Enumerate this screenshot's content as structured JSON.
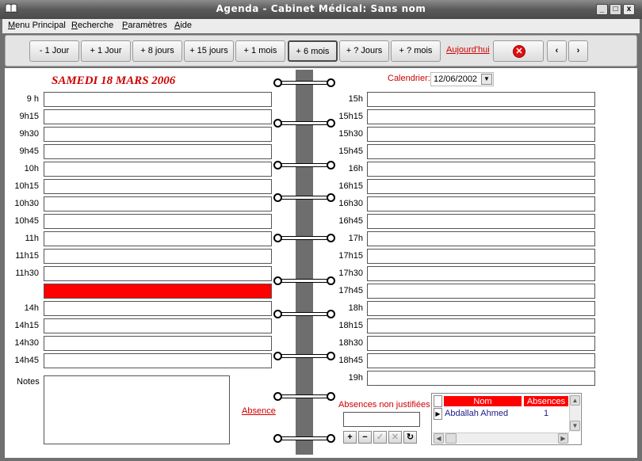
{
  "window": {
    "title": "Agenda - Cabinet Médical: Sans nom",
    "minimize": "_",
    "maximize": "□",
    "close": "x"
  },
  "menu": [
    {
      "label": "Menu Principal",
      "u": "M",
      "rest": "enu Principal"
    },
    {
      "label": "Recherche",
      "u": "R",
      "rest": "echerche"
    },
    {
      "label": "Paramètres",
      "u": "P",
      "rest": "aramètres"
    },
    {
      "label": "Aide",
      "u": "A",
      "rest": "ide"
    }
  ],
  "toolbar": {
    "buttons": [
      "- 1 Jour",
      "+ 1 Jour",
      "+ 8 jours",
      "+ 15 jours",
      "+ 1 mois",
      "+ 6 mois",
      "+ ? Jours",
      "+ ? mois"
    ],
    "today": "Aujourd'hui",
    "prev": "‹",
    "next": "›"
  },
  "day": {
    "title": "SAMEDI 18 MARS 2006"
  },
  "calendar": {
    "label": "Calendrier:",
    "value": "12/06/2002"
  },
  "left_slots": [
    "9 h",
    "9h15",
    "9h30",
    "9h45",
    "10h",
    "10h15",
    "10h30",
    "10h45",
    "11h",
    "11h15",
    "11h30",
    "",
    "14h",
    "14h15",
    "14h30",
    "14h45"
  ],
  "right_slots": [
    "15h",
    "15h15",
    "15h30",
    "15h45",
    "16h",
    "16h15",
    "16h30",
    "16h45",
    "17h",
    "17h15",
    "17h30",
    "17h45",
    "18h",
    "18h15",
    "18h30",
    "18h45",
    "19h"
  ],
  "busy_slot_index": 11,
  "notes": {
    "label": "Notes"
  },
  "absence": {
    "link": "Absence",
    "non_justified_label": "Absences non justifiées"
  },
  "absences_grid": {
    "columns": [
      "Nom",
      "Absences"
    ],
    "rows": [
      {
        "nom": "Abdallah Ahmed",
        "absences": "1"
      }
    ]
  },
  "nav_buttons": [
    "+",
    "−",
    "✓",
    "✕",
    "↻"
  ]
}
